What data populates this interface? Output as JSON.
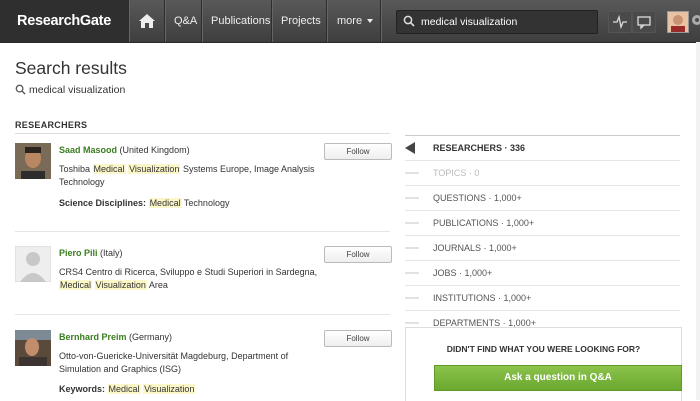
{
  "nav": {
    "logo": "ResearchGate",
    "items": [
      "Q&A",
      "Publications",
      "Projects"
    ],
    "more_label": "more",
    "search_value": "medical visualization"
  },
  "page": {
    "title": "Search results",
    "query": "medical visualization",
    "section_label": "RESEARCHERS"
  },
  "researchers": [
    {
      "name": "Saad Masood",
      "location": "(United Kingdom)",
      "follow_label": "Follow",
      "desc_pre": "Toshiba",
      "desc_hl1": "Medical",
      "desc_hl2": "Visualization",
      "desc_post": "Systems Europe, Image Analysis Technology",
      "meta_key": "Science Disciplines:",
      "meta_hl": "Medical",
      "meta_post": "Technology"
    },
    {
      "name": "Piero Pili",
      "location": "(Italy)",
      "follow_label": "Follow",
      "desc_pre": "CRS4 Centro di Ricerca, Sviluppo e Studi Superiori in Sardegna,",
      "desc_hl1": "Medical",
      "desc_hl2": "Visualization",
      "desc_post": "Area"
    },
    {
      "name": "Bernhard Preim",
      "location": "(Germany)",
      "follow_label": "Follow",
      "desc_text": "Otto-von-Guericke-Universität Magdeburg, Department of Simulation and Graphics (ISG)",
      "meta_key": "Keywords:",
      "meta_hl1": "Medical",
      "meta_hl2": "Visualization"
    }
  ],
  "facets": [
    {
      "label": "RESEARCHERS · 336",
      "state": "active"
    },
    {
      "label": "TOPICS · 0",
      "state": "disabled"
    },
    {
      "label": "QUESTIONS · 1,000+",
      "state": "normal"
    },
    {
      "label": "PUBLICATIONS · 1,000+",
      "state": "normal"
    },
    {
      "label": "JOURNALS · 1,000+",
      "state": "normal"
    },
    {
      "label": "JOBS · 1,000+",
      "state": "normal"
    },
    {
      "label": "INSTITUTIONS · 1,000+",
      "state": "normal"
    },
    {
      "label": "DEPARTMENTS · 1,000+",
      "state": "normal"
    }
  ],
  "notfound": {
    "title": "DIDN'T FIND WHAT YOU WERE LOOKING FOR?",
    "button": "Ask a question in Q&A"
  },
  "colors": {
    "nav_bg": "#4a4a4a",
    "name_green": "#3a7d1f",
    "highlight": "#fbf7c8",
    "ask_button": "#78b43a"
  }
}
